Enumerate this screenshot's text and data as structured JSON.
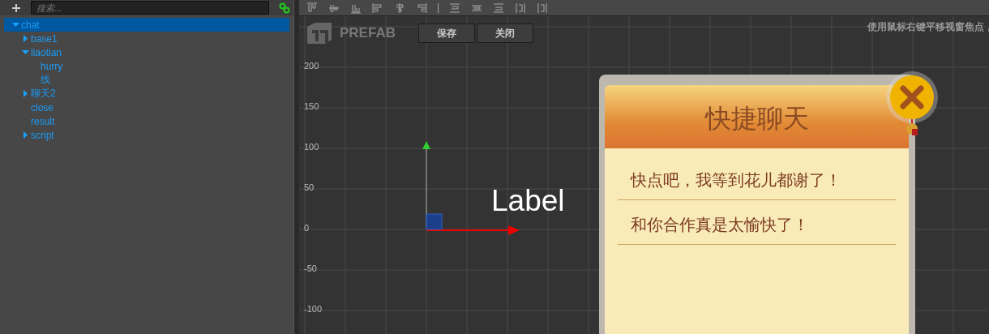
{
  "search": {
    "placeholder": "搜索..."
  },
  "tree": [
    {
      "label": "chat",
      "selected": true,
      "expanded": true,
      "children": [
        {
          "label": "base1",
          "selected": false,
          "expanded": false
        },
        {
          "label": "liaotian",
          "selected": false,
          "expanded": true,
          "children": [
            {
              "label": "hurry",
              "selected": false
            },
            {
              "label": "线",
              "selected": false
            }
          ]
        },
        {
          "label": "聊天2",
          "selected": false,
          "expanded": false
        },
        {
          "label": "close",
          "selected": false
        },
        {
          "label": "result",
          "selected": false
        },
        {
          "label": "script",
          "selected": false,
          "expanded": false
        }
      ]
    }
  ],
  "prefab": {
    "title": "PREFAB",
    "buttons": [
      "保存",
      "关闭"
    ]
  },
  "hint": "使用鼠标右键平移视窗焦点，",
  "y_axis_labels": [
    "200",
    "150",
    "100",
    "50",
    "0",
    "-50",
    "-100"
  ],
  "canvas_label": "Label",
  "dialog": {
    "title": "快捷聊天",
    "messages": [
      "快点吧，我等到花儿都谢了！",
      "和你合作真是太愉快了！"
    ]
  }
}
